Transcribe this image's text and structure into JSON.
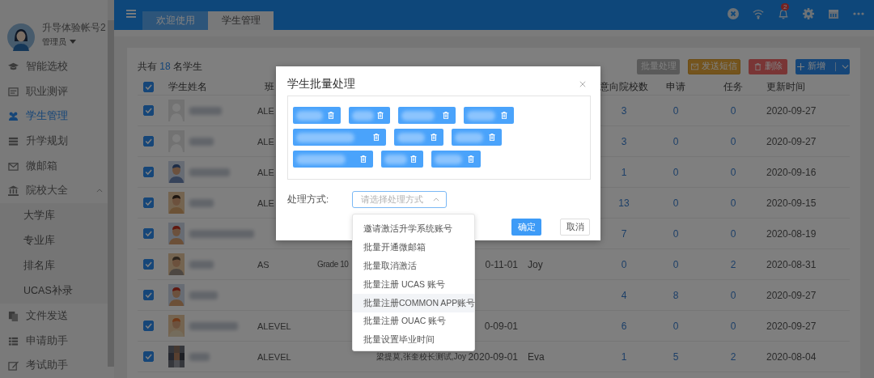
{
  "sidebar": {
    "user": {
      "name": "升导体验帐号2",
      "role": "管理员"
    },
    "menu": [
      {
        "label": "智能选校",
        "selected": false
      },
      {
        "label": "职业测评",
        "selected": false
      },
      {
        "label": "学生管理",
        "selected": true
      },
      {
        "label": "升学规划",
        "selected": false
      },
      {
        "label": "微邮箱",
        "selected": false
      },
      {
        "label": "院校大全",
        "selected": false,
        "expanded": true,
        "children": [
          {
            "label": "大学库",
            "selected": false
          },
          {
            "label": "专业库",
            "selected": false
          },
          {
            "label": "排名库",
            "selected": false
          },
          {
            "label": "UCAS补录",
            "selected": false
          }
        ]
      },
      {
        "label": "文件发送",
        "selected": false
      },
      {
        "label": "申请助手",
        "selected": false
      },
      {
        "label": "考试助手",
        "selected": false
      }
    ]
  },
  "topbar": {
    "tabs": [
      {
        "label": "欢迎使用",
        "selected": false
      },
      {
        "label": "学生管理",
        "selected": true
      }
    ],
    "notification_count": "2"
  },
  "main": {
    "summary": {
      "prefix": "共有",
      "count": "18",
      "suffix": "名学生"
    },
    "toolbar": [
      {
        "label": "批量处理",
        "kind": "neutral"
      },
      {
        "label": "发送短信",
        "kind": "warning"
      },
      {
        "label": "删除",
        "kind": "danger"
      },
      {
        "label": "新增",
        "kind": "primary"
      }
    ],
    "table": {
      "all_checked": true,
      "columns": [
        "学生姓名",
        "班",
        "意向院校数",
        "申请",
        "任务",
        "更新时间"
      ],
      "rows": [
        {
          "checked": true,
          "avatar": {
            "kind": "blank"
          },
          "class": "ALE",
          "schools": "3",
          "applications": "0",
          "tasks": "0",
          "updated": "2020-09-27"
        },
        {
          "checked": true,
          "avatar": {
            "kind": "blank"
          },
          "class": "ALE",
          "schools": "3",
          "applications": "0",
          "tasks": "0",
          "updated": "2020-09-27"
        },
        {
          "checked": true,
          "avatar": {
            "kind": "portrait"
          },
          "class": "ALE",
          "schools": "1",
          "applications": "0",
          "tasks": "0",
          "updated": "2020-09-16"
        },
        {
          "checked": true,
          "avatar": {
            "kind": "portrait"
          },
          "class": "ALE",
          "schools": "13",
          "applications": "0",
          "tasks": "0",
          "updated": "2020-09-15"
        },
        {
          "checked": true,
          "avatar": {
            "kind": "portrait"
          },
          "schools": "7",
          "applications": "0",
          "tasks": "0",
          "updated": "2020-08-19"
        },
        {
          "checked": true,
          "avatar": {
            "kind": "portrait"
          },
          "class": "AS",
          "column_4": "Grade 10",
          "column_6": "0-11-01",
          "column_7": "Joy",
          "schools": "0",
          "applications": "0",
          "tasks": "2",
          "updated": "2020-08-31"
        },
        {
          "checked": true,
          "avatar": {
            "kind": "portrait"
          },
          "schools": "4",
          "applications": "8",
          "tasks": "0",
          "updated": "2020-09-27"
        },
        {
          "checked": true,
          "avatar": {
            "kind": "portrait"
          },
          "class": "ALEVEL",
          "column_6": "0-09-01",
          "schools": "6",
          "applications": "0",
          "tasks": "0",
          "updated": "2020-09-27"
        },
        {
          "checked": true,
          "avatar": {
            "kind": "mosaic"
          },
          "class": "ALEVEL",
          "column_5": "梁提莫,张奎校长测试,Joy",
          "column_6": "2020-09-01",
          "column_7": "Eva",
          "schools": "1",
          "applications": "5",
          "tasks": "2",
          "updated": "2020-08-04"
        }
      ]
    }
  },
  "modal": {
    "title": "学生批量处理",
    "chips": [
      {
        "kind": "blurred"
      },
      {
        "kind": "blurred"
      },
      {
        "kind": "blurred"
      },
      {
        "kind": "blurred"
      },
      {
        "kind": "blurred"
      },
      {
        "kind": "blurred"
      },
      {
        "kind": "blurred"
      },
      {
        "kind": "blurred"
      },
      {
        "kind": "blurred"
      },
      {
        "kind": "blurred"
      }
    ],
    "method_label": "处理方式:",
    "select": {
      "placeholder": "请选择处理方式",
      "open": true
    },
    "options": [
      {
        "label": "邀请激活升学系统账号",
        "highlighted": false
      },
      {
        "label": "批量开通微邮箱",
        "highlighted": false
      },
      {
        "label": "批量取消激活",
        "highlighted": false
      },
      {
        "label": "批量注册 UCAS 账号",
        "highlighted": false
      },
      {
        "label": "批量注册COMMON APP账号",
        "highlighted": true
      },
      {
        "label": "批量注册 OUAC 账号",
        "highlighted": false
      },
      {
        "label": "批量设置毕业时间",
        "highlighted": false
      }
    ],
    "buttons": [
      {
        "label": "确定",
        "kind": "primary"
      },
      {
        "label": "取消",
        "kind": "default"
      }
    ]
  }
}
